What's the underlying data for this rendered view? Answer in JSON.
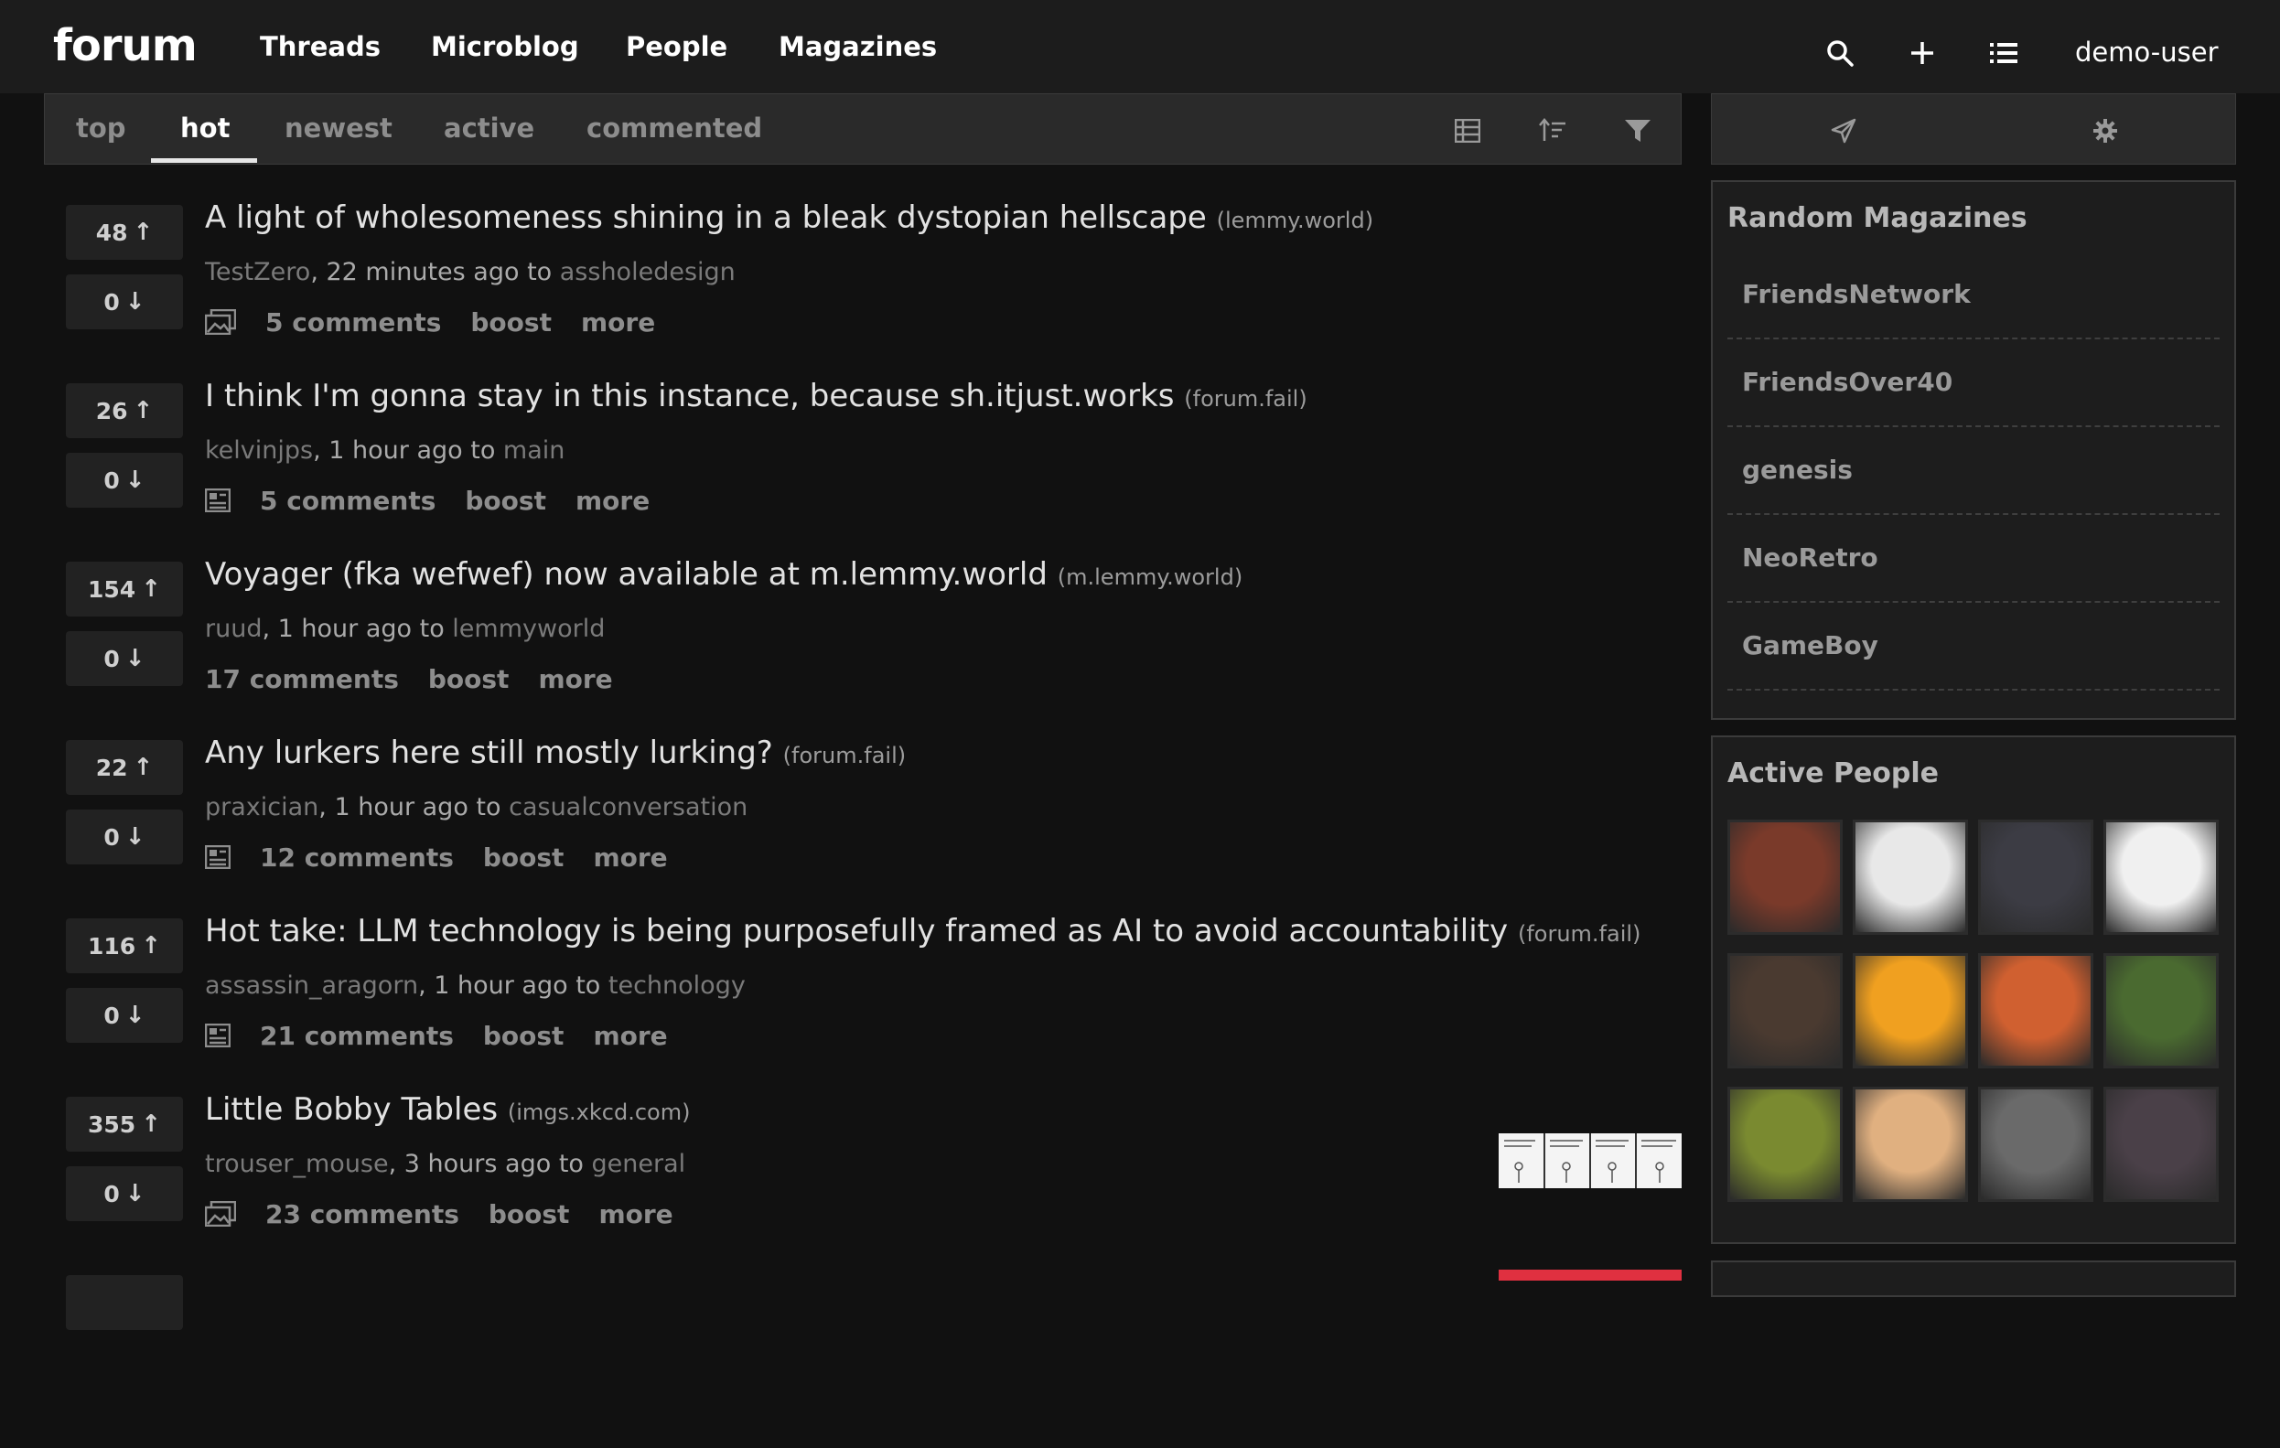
{
  "header": {
    "logo": "forum",
    "nav": [
      "Threads",
      "Microblog",
      "People",
      "Magazines"
    ],
    "username": "demo-user"
  },
  "sort_tabs": [
    "top",
    "hot",
    "newest",
    "active",
    "commented"
  ],
  "active_tab": "hot",
  "posts": [
    {
      "up": "48",
      "down": "0",
      "title": "A light of wholesomeness shining in a bleak dystopian hellscape",
      "domain": "(lemmy.world)",
      "user": "TestZero",
      "time": ", 22 minutes ago to ",
      "magazine": "assholedesign",
      "comments": "5 comments",
      "boost": "boost",
      "more": "more",
      "icon": "image-icon"
    },
    {
      "up": "26",
      "down": "0",
      "title": "I think I'm gonna stay in this instance, because sh.itjust.works",
      "domain": "(forum.fail)",
      "user": "kelvinjps",
      "time": ", 1 hour ago to ",
      "magazine": "main",
      "comments": "5 comments",
      "boost": "boost",
      "more": "more",
      "icon": "article-icon"
    },
    {
      "up": "154",
      "down": "0",
      "title": "Voyager (fka wefwef) now available at m.lemmy.world",
      "domain": "(m.lemmy.world)",
      "user": "ruud",
      "time": ", 1 hour ago to ",
      "magazine": "lemmyworld",
      "comments": "17 comments",
      "boost": "boost",
      "more": "more",
      "icon": ""
    },
    {
      "up": "22",
      "down": "0",
      "title": "Any lurkers here still mostly lurking?",
      "domain": "(forum.fail)",
      "user": "praxician",
      "time": ", 1 hour ago to ",
      "magazine": "casualconversation",
      "comments": "12 comments",
      "boost": "boost",
      "more": "more",
      "icon": "article-icon"
    },
    {
      "up": "116",
      "down": "0",
      "title": "Hot take: LLM technology is being purposefully framed as AI to avoid accountability",
      "domain": "(forum.fail)",
      "user": "assassin_aragorn",
      "time": ", 1 hour ago to ",
      "magazine": "technology",
      "comments": "21 comments",
      "boost": "boost",
      "more": "more",
      "icon": "article-icon"
    },
    {
      "up": "355",
      "down": "0",
      "title": "Little Bobby Tables",
      "domain": "(imgs.xkcd.com)",
      "user": "trouser_mouse",
      "time": ", 3 hours ago to ",
      "magazine": "general",
      "comments": "23 comments",
      "boost": "boost",
      "more": "more",
      "icon": "image-icon"
    }
  ],
  "sidebar": {
    "random_title": "Random Magazines",
    "magazines": [
      "FriendsNetwork",
      "FriendsOver40",
      "genesis",
      "NeoRetro",
      "GameBoy"
    ],
    "people_title": "Active People",
    "avatar_colors": [
      "#7a3a2a",
      "#e8e8e8",
      "#3c3c44",
      "#f0f0f0",
      "#4a3a30",
      "#f0a020",
      "#d06030",
      "#4a6a30",
      "#7a8a30",
      "#e0b080",
      "#6a6a6a",
      "#4a4048"
    ]
  }
}
